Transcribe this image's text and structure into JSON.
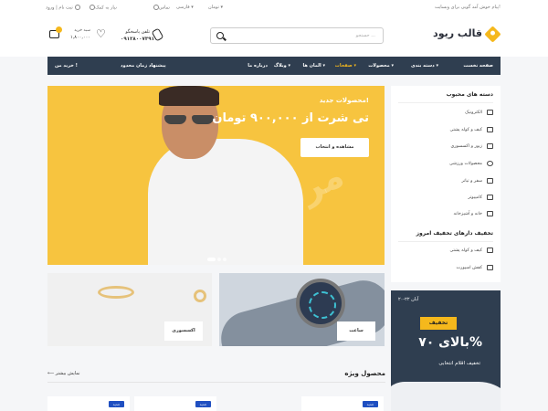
{
  "topbar": {
    "welcome": "پیام خوش آمد گویی برای وبسایت!",
    "currency": "تومان",
    "language": "فارسی",
    "contact": "تماس",
    "help": "نیاز به کمک",
    "login": "ورود",
    "register": "ثبت نام"
  },
  "header": {
    "logo": "قالب ریود",
    "search_placeholder": "جستجو ...",
    "support_label": "تلفن پاسخگو",
    "support_phone": "۰۹۱۲۸۰۰۷۳۹۱",
    "cart_label": "سبد خرید",
    "cart_count": "۲",
    "cart_amount": "۱,۸۰۰,۰۰۰"
  },
  "nav": {
    "items": [
      {
        "label": "صفحه نخست"
      },
      {
        "label": "دسته بندی"
      },
      {
        "label": "محصولات"
      },
      {
        "label": "صفحات"
      },
      {
        "label": "المان ها"
      },
      {
        "label": "وبلاگ"
      },
      {
        "label": "درباره ما"
      }
    ],
    "special_offer": "پیشنهاد زمان محدود",
    "buy_label": "خرید من !"
  },
  "sidebar": {
    "popular_title": "دسته های محبوب",
    "categories": [
      {
        "label": "الکترونیک",
        "icon": "camera-icon"
      },
      {
        "label": "کیف و کوله پشتی",
        "icon": "bag-icon"
      },
      {
        "label": "زیور و اکسسوری",
        "icon": "ring-icon"
      },
      {
        "label": "محصولات ورزشی",
        "icon": "ball-icon"
      },
      {
        "label": "سفر و تیاتر",
        "icon": "plane-icon"
      },
      {
        "label": "کامپیوتر",
        "icon": "computer-icon"
      },
      {
        "label": "خانه و آشپزخانه",
        "icon": "home-icon"
      }
    ],
    "discount_title": "تخفیف دارهای تخفیف امروز",
    "discount_items": [
      {
        "label": "کیف و کوله پشتی",
        "icon": "tag-icon"
      },
      {
        "label": "کفش اسپورت",
        "icon": "tag-icon"
      }
    ]
  },
  "hero": {
    "subtitle": "محصولات جدید!",
    "title": "تی شرت از ۹۰۰,۰۰۰ تومان",
    "button": "مشاهده و انتخاب",
    "watermark": "مردانه"
  },
  "banners": [
    {
      "label": "ساعت"
    },
    {
      "label": "اکسسوری"
    }
  ],
  "products": {
    "title": "محصول ویژه",
    "show_more": "نمایش بیشتر",
    "badge": "جدید"
  },
  "promo": {
    "date": "۲۰-۲۲ آبان",
    "tag": "تخفیف",
    "big": "بالای ۷۰%",
    "small": "تخفیف اقلام انتخابی"
  },
  "colors": {
    "accent": "#f5b81c",
    "nav_bg": "#2f3e50",
    "badge": "#1f4fc1"
  }
}
